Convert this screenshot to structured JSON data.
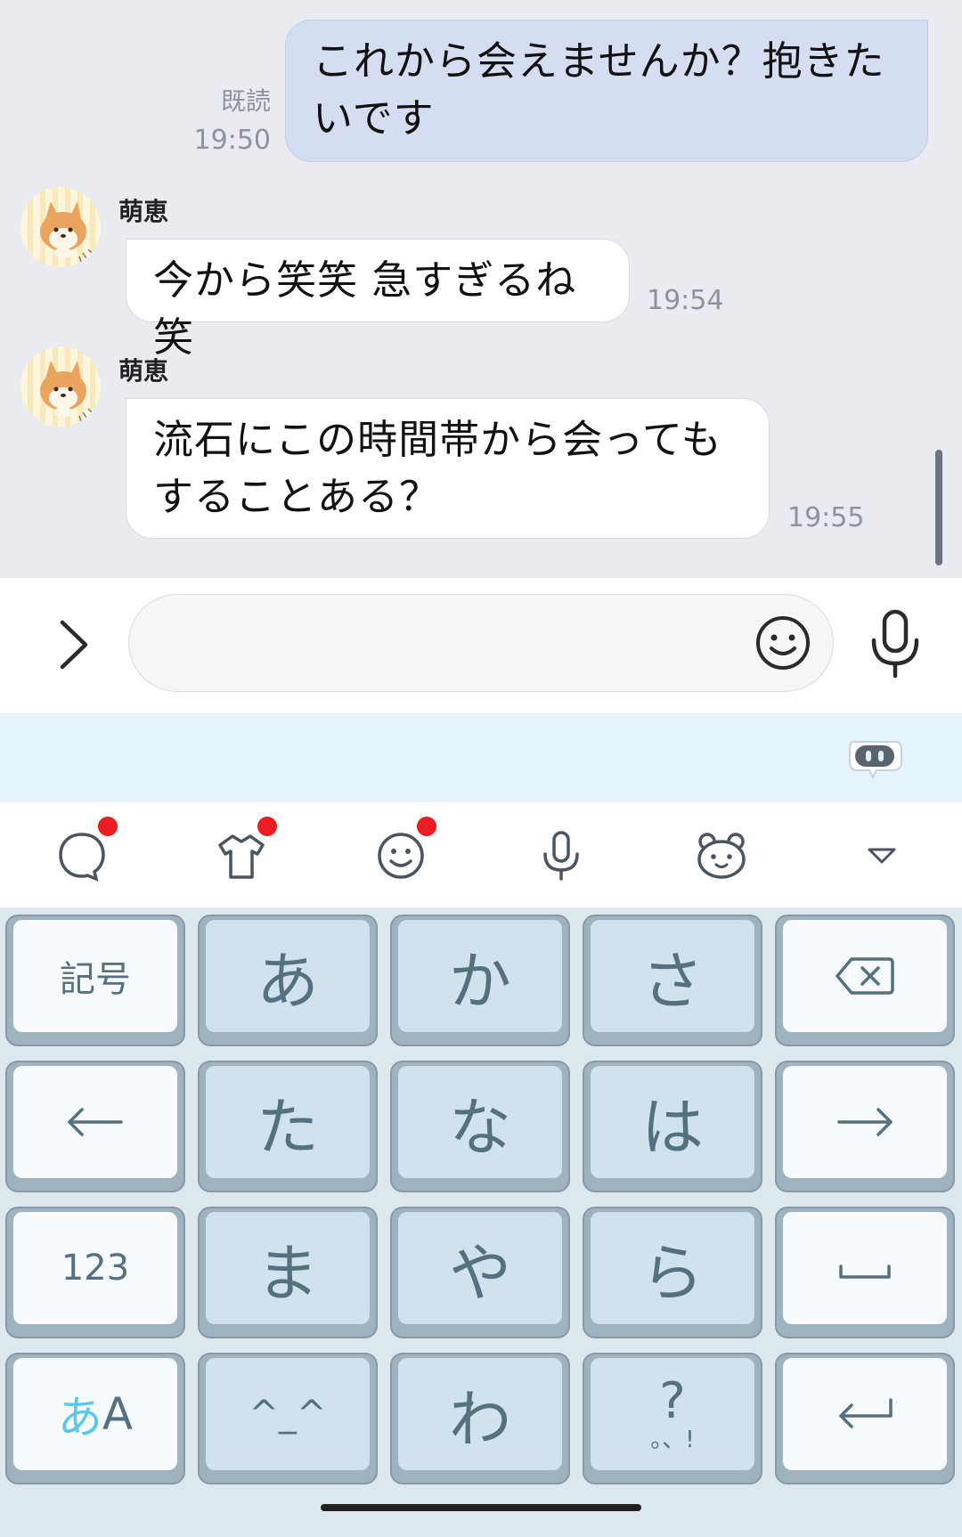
{
  "messages": [
    {
      "side": "out",
      "text": "これから会えませんか？抱きた\nいです",
      "read": "既読",
      "time": "19:50"
    },
    {
      "side": "in",
      "sender": "萌恵",
      "text": "今から笑笑 急すぎるね笑",
      "time": "19:54"
    },
    {
      "side": "in",
      "sender": "萌恵",
      "text": "流石にこの時間帯から会っても\nすることある？",
      "time": "19:55"
    }
  ],
  "input": {
    "value": "",
    "placeholder": ""
  },
  "toolbar": {
    "items": [
      "chat-bubble",
      "shirt",
      "smiley",
      "microphone",
      "bear",
      "collapse"
    ],
    "badge_color": "#ec1c24"
  },
  "keyboard": {
    "rows": [
      [
        "記号",
        "あ",
        "か",
        "さ",
        "⌫"
      ],
      [
        "←",
        "た",
        "な",
        "は",
        "→"
      ],
      [
        "123",
        "ま",
        "や",
        "ら",
        "␣"
      ],
      [
        "あA",
        "^_^",
        "わ",
        "?",
        "↵"
      ]
    ],
    "mode_kana": "あ",
    "mode_latin": "A",
    "punct_sub": "。、!"
  },
  "colors": {
    "chat_bg": "#e9ebf1",
    "outgoing_bubble": "#d4ddf2",
    "incoming_bubble": "#ffffff",
    "suggest_strip": "#e5f4fc",
    "key_blue": "#cfe2ed",
    "key_light": "#f6fafc"
  }
}
